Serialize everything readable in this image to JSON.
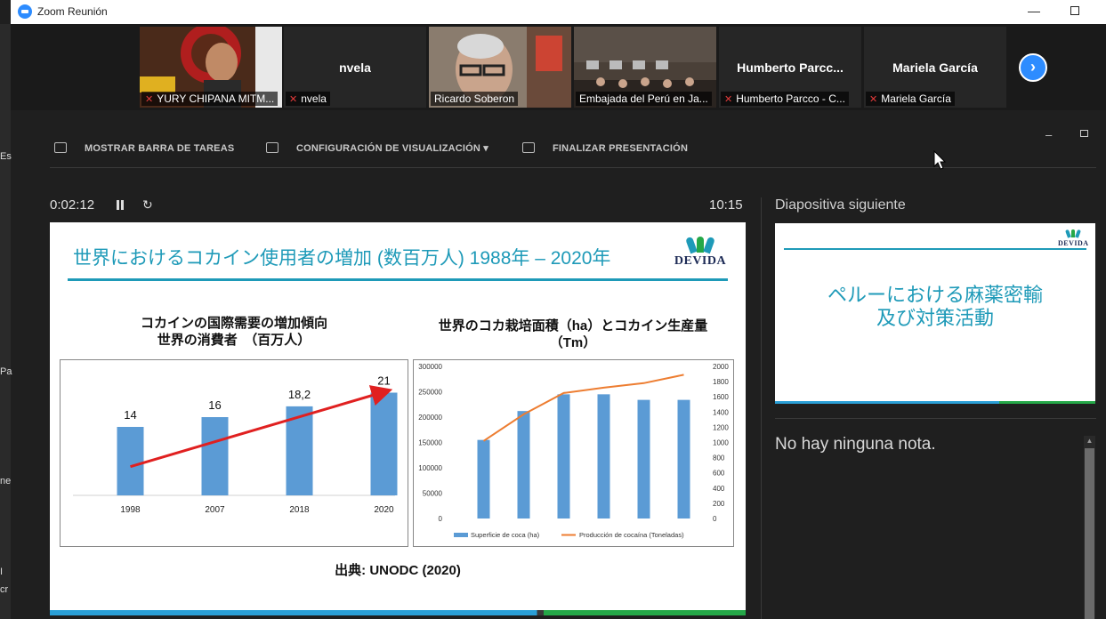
{
  "window": {
    "title": "Zoom Reunión",
    "minimize_glyph": "—",
    "maximize_glyph": ""
  },
  "left_strip": {
    "fragments": [
      "Es",
      "Pa",
      "ne",
      "I",
      "cr"
    ]
  },
  "participants": [
    {
      "label": "YURY CHIPANA MITM...",
      "big_name": "",
      "muted": true,
      "video": true
    },
    {
      "label": "nvela",
      "big_name": "nvela",
      "muted": true,
      "video": false
    },
    {
      "label": "Ricardo Soberon",
      "big_name": "",
      "muted": false,
      "video": true
    },
    {
      "label": "Embajada del Perú en Ja...",
      "big_name": "",
      "muted": false,
      "video": true,
      "active_speaker": true
    },
    {
      "label": "Humberto Parcco - C...",
      "big_name": "Humberto  Parcc...",
      "muted": true,
      "video": false
    },
    {
      "label": "Mariela García",
      "big_name": "Mariela García",
      "muted": true,
      "video": false
    }
  ],
  "next_participants_glyph": "›",
  "toolbar": {
    "show_taskbar": "MOSTRAR BARRA DE TAREAS",
    "view_settings": "CONFIGURACIÓN DE VISUALIZACIÓN ▾",
    "end_presentation": "FINALIZAR PRESENTACIÓN",
    "minimize_glyph": "–"
  },
  "presenter": {
    "elapsed": "0:02:12",
    "clock": "10:15",
    "reload_glyph": "↻"
  },
  "slide": {
    "title": "世界におけるコカイン使用者の増加 (数百万人) 1988年 – 2020年",
    "logo_text": "DEVIDA",
    "left_heading_line1": "コカインの国際需要の増加傾向",
    "left_heading_line2": "世界の消費者　（百万人）",
    "right_heading_line1": "世界のコカ栽培面積（ha）とコカイン生産量",
    "right_heading_line2": "（Tm）",
    "source": "出典: UNODC (2020)"
  },
  "chart_data": [
    {
      "type": "bar",
      "categories": [
        "1998",
        "2007",
        "2018",
        "2020"
      ],
      "values": [
        14,
        16,
        18.2,
        21
      ],
      "value_labels": [
        "14",
        "16",
        "18,2",
        "21"
      ],
      "ylim": [
        0,
        24
      ],
      "bar_color": "#5b9bd5",
      "trend_arrow_color": "#e02020"
    },
    {
      "type": "bar",
      "bar_series_name": "Superficie de coca (ha)",
      "line_series_name": "Producción de cocaína (Toneladas)",
      "bar_values": [
        155000,
        212000,
        245000,
        245000,
        234000,
        234000
      ],
      "line_values": [
        1020,
        1370,
        1650,
        1720,
        1780,
        1890
      ],
      "y_left_ticks": [
        "300000",
        "250000",
        "200000",
        "150000",
        "100000",
        "50000",
        "0"
      ],
      "y_right_ticks": [
        "2000",
        "1800",
        "1600",
        "1400",
        "1200",
        "1000",
        "800",
        "600",
        "400",
        "200",
        "0"
      ],
      "ylim_left": [
        0,
        300000
      ],
      "ylim_right": [
        0,
        2000
      ],
      "bar_color": "#5b9bd5",
      "line_color": "#ed7d31"
    }
  ],
  "next_panel": {
    "label": "Diapositiva siguiente",
    "slide_title_line1": "ペルーにおける麻薬密輸",
    "slide_title_line2": "及び対策活動",
    "logo_text": "DEVIDA"
  },
  "notes": {
    "text": "No hay ninguna nota.",
    "scroll_up_glyph": "▲"
  },
  "colors": {
    "zoom_blue": "#2D8CFF",
    "slide_teal": "#1e9ab8",
    "active_border": "#8bbf3a"
  }
}
